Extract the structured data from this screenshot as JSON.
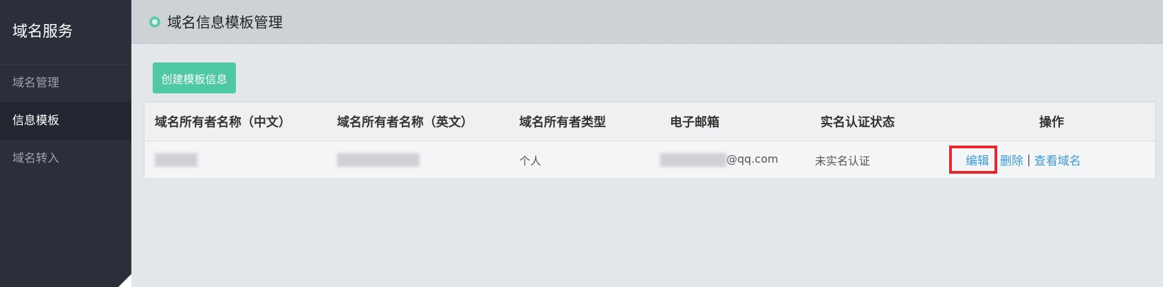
{
  "sidebar": {
    "title": "域名服务",
    "items": [
      {
        "label": "域名管理"
      },
      {
        "label": "信息模板"
      },
      {
        "label": "域名转入"
      }
    ]
  },
  "header": {
    "title": "域名信息模板管理"
  },
  "toolbar": {
    "create_label": "创建模板信息"
  },
  "table": {
    "columns": [
      "域名所有者名称（中文）",
      "域名所有者名称（英文）",
      "域名所有者类型",
      "电子邮箱",
      "实名认证状态",
      "操作"
    ],
    "rows": [
      {
        "owner_cn": "",
        "owner_en": "",
        "owner_type": "个人",
        "email_suffix": "@qq.com",
        "status": "未实名认证",
        "actions": {
          "edit": "编辑",
          "delete": "删除",
          "sep": "|",
          "view": "查看域名"
        }
      }
    ]
  },
  "colors": {
    "accent": "#4fc9a4",
    "link": "#3a9bd9",
    "sidebar_bg": "#2b2f3a",
    "highlight": "#e8262b"
  }
}
